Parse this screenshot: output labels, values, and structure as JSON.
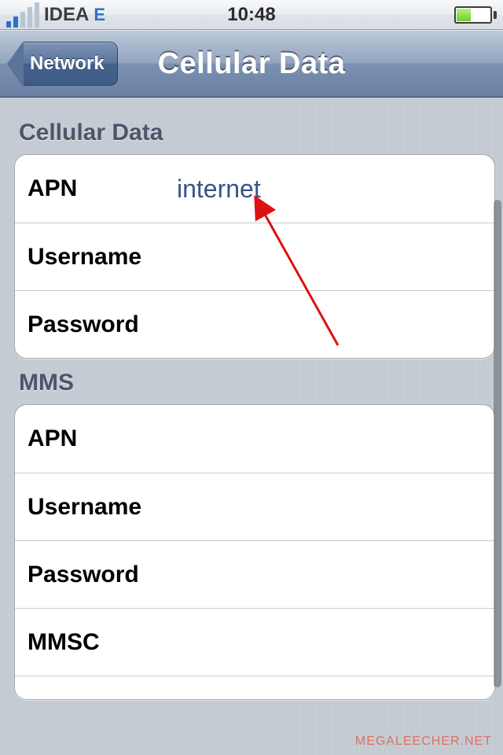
{
  "statusbar": {
    "carrier": "IDEA",
    "network_badge": "E",
    "time": "10:48"
  },
  "navbar": {
    "back_label": "Network",
    "title": "Cellular Data"
  },
  "sections": {
    "cellular": {
      "header": "Cellular Data",
      "rows": {
        "apn": {
          "label": "APN",
          "value": "internet"
        },
        "username": {
          "label": "Username",
          "value": ""
        },
        "password": {
          "label": "Password",
          "value": ""
        }
      }
    },
    "mms": {
      "header": "MMS",
      "rows": {
        "apn": {
          "label": "APN",
          "value": ""
        },
        "username": {
          "label": "Username",
          "value": ""
        },
        "password": {
          "label": "Password",
          "value": ""
        },
        "mmsc": {
          "label": "MMSC",
          "value": ""
        }
      }
    }
  },
  "watermark": "MEGALEECHER.NET"
}
